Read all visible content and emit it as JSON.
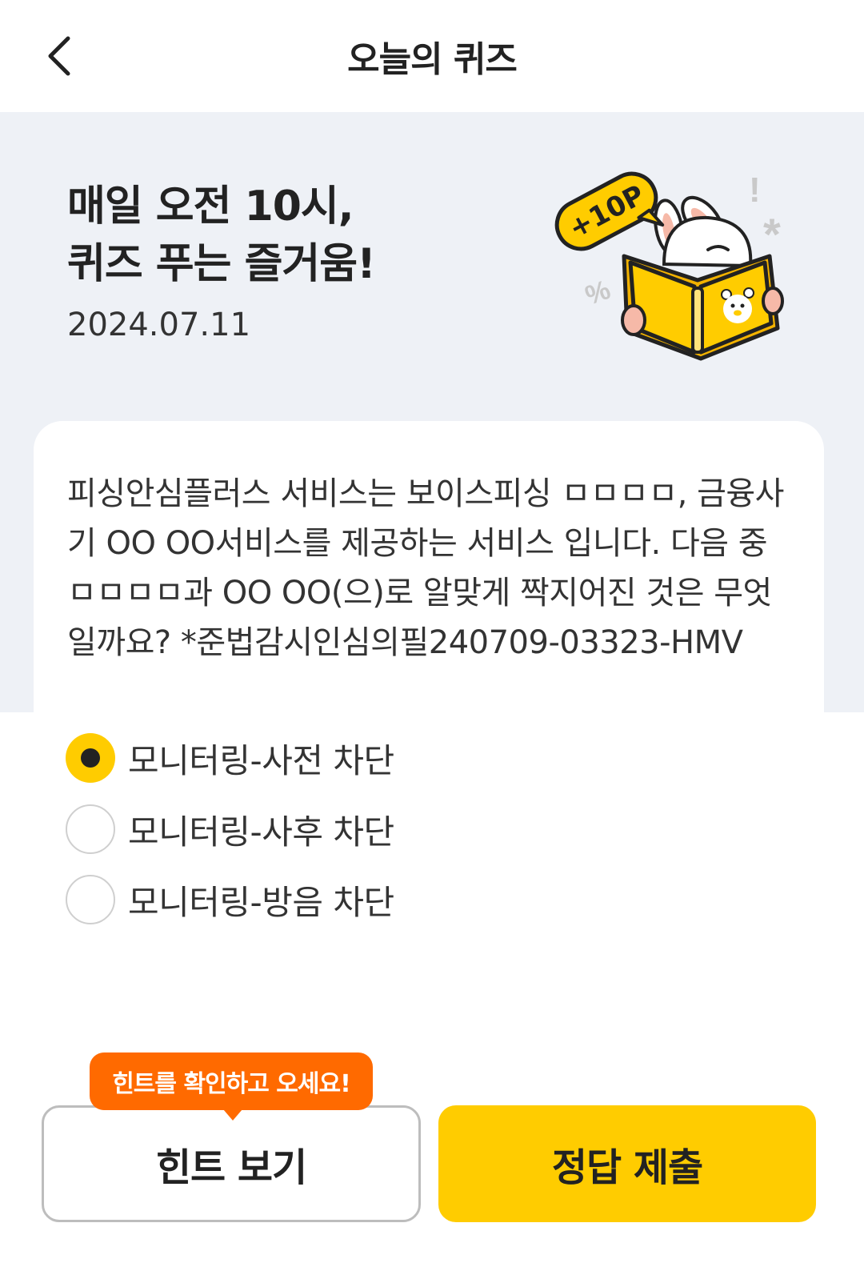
{
  "header": {
    "title": "오늘의 퀴즈",
    "back_icon": "chevron-left-icon"
  },
  "hero": {
    "headline_line1": "매일 오전 10시,",
    "headline_line2": "퀴즈 푸는 즐거움!",
    "date": "2024.07.11",
    "illustration": {
      "badge_text": "+10P",
      "exclaim": "!",
      "asterisk": "*",
      "percent": "%"
    }
  },
  "quiz": {
    "question": "피싱안심플러스 서비스는 보이스피싱 ㅁㅁㅁㅁ, 금융사기 OO OO서비스를 제공하는 서비스 입니다. 다음 중 ㅁㅁㅁㅁ과 OO OO(으)로 알맞게 짝지어진 것은 무엇일까요? *준법감시인심의필240709-03323-HMV",
    "options": [
      {
        "label": "모니터링-사전 차단",
        "selected": true
      },
      {
        "label": "모니터링-사후 차단",
        "selected": false
      },
      {
        "label": "모니터링-방음 차단",
        "selected": false
      }
    ]
  },
  "hint_tooltip": "힌트를 확인하고 오세요!",
  "buttons": {
    "hint_label": "힌트 보기",
    "submit_label": "정답 제출"
  },
  "colors": {
    "accent_yellow": "#ffcc00",
    "tooltip_orange": "#ff6a00",
    "band_grey": "#eef1f6"
  }
}
